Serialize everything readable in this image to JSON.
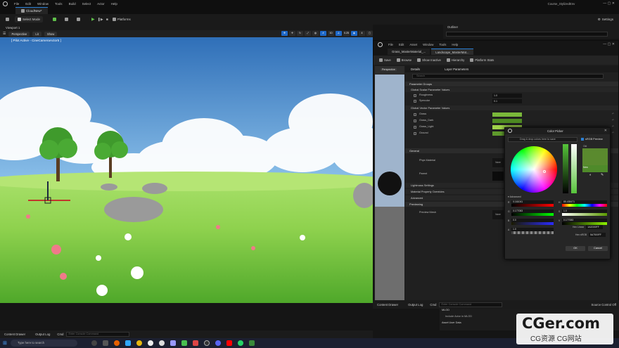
{
  "app": {
    "project": "Course_StylizedEnv",
    "menu": [
      "File",
      "Edit",
      "Window",
      "Tools",
      "Build",
      "Select",
      "Actor",
      "Help"
    ],
    "level_tab": "CloudNew*"
  },
  "toolbar": {
    "select_mode": "Select Mode",
    "platforms": "Platforms",
    "settings": "Settings"
  },
  "viewport": {
    "tab": "Viewport 1",
    "perspective": "Perspective",
    "lit": "Lit",
    "show": "Show",
    "pilot": "[ Pilot Active - CineCameraActor5 ]",
    "icon_values": [
      "10",
      "0.25",
      "4"
    ]
  },
  "outliner": {
    "title": "Outliner"
  },
  "material_window": {
    "menu": [
      "File",
      "Edit",
      "Asset",
      "Window",
      "Tools",
      "Help"
    ],
    "tabs": [
      "Grass_MasterMaterial_...",
      "Landscape_MasterMat..."
    ],
    "toolbar": [
      "Save",
      "Browse",
      "Show Inactive",
      "Hierarchy",
      "Platform Stats"
    ],
    "preview_label": "Perspective",
    "details_tab": "Details",
    "layer_tab": "Layer Parameters",
    "search_placeholder": "Search",
    "sections": {
      "parameter_groups": "Parameter Groups",
      "scalar": "Global Scalar Parameter Values",
      "vector": "Global Vector Parameter Values",
      "general": "General",
      "phys_material": "Phys Material",
      "parent": "Parent",
      "lightmass": "Lightmass Settings",
      "mpi": "Material Property Overrides",
      "advanced": "Advanced",
      "previewing": "Previewing",
      "preview_mesh": "Preview Mesh",
      "none1": "None",
      "none2": "None"
    },
    "scalars": [
      {
        "name": "Roughness",
        "value": "1.0"
      },
      {
        "name": "Specular",
        "value": "0.1"
      }
    ],
    "vectors": [
      {
        "name": "Grass",
        "color": "#7ab83a"
      },
      {
        "name": "Grass_Dark",
        "color": "#4e8a22"
      },
      {
        "name": "Grass_Light",
        "color": "#9fd24a"
      },
      {
        "name": "Ground",
        "color": "#5f9a2c"
      }
    ]
  },
  "color_picker": {
    "title": "Color Picker",
    "drop_hint": "Drag & drop colors here to save",
    "srgb_preview": "sRGB Preview",
    "old": "Old",
    "new": "New",
    "advanced": "Advanced",
    "r_label": "R",
    "g_label": "G",
    "b_label": "B",
    "a_label": "A",
    "h_label": "H",
    "s_label": "S",
    "v_label": "V",
    "r": "0.161041",
    "g": "0.177083",
    "b": "0.0",
    "a": "1.0",
    "h": "85.435471",
    "s": "1.0",
    "v": "0.177083",
    "hex_linear_label": "Hex Linear",
    "hex_linear": "1A2D00FF",
    "hex_srgb_label": "Hex sRGB",
    "hex_srgb": "5A7500FF",
    "ok": "OK",
    "cancel": "Cancel",
    "new_color": "#4f8a2a"
  },
  "bottom": {
    "content_drawer": "Content Drawer",
    "output_log": "Output Log",
    "cmd": "Cmd",
    "console_placeholder": "Enter Console Command",
    "source_control": "Source Control Off",
    "mlod": "MLOD",
    "include_actor": "Include Actor in MLOD",
    "asset_user_data": "Asset User Data"
  },
  "taskbar": {
    "search": "Type here to search"
  },
  "watermark": {
    "big": "CGer.com",
    "small": "CG资源 CG网站"
  }
}
